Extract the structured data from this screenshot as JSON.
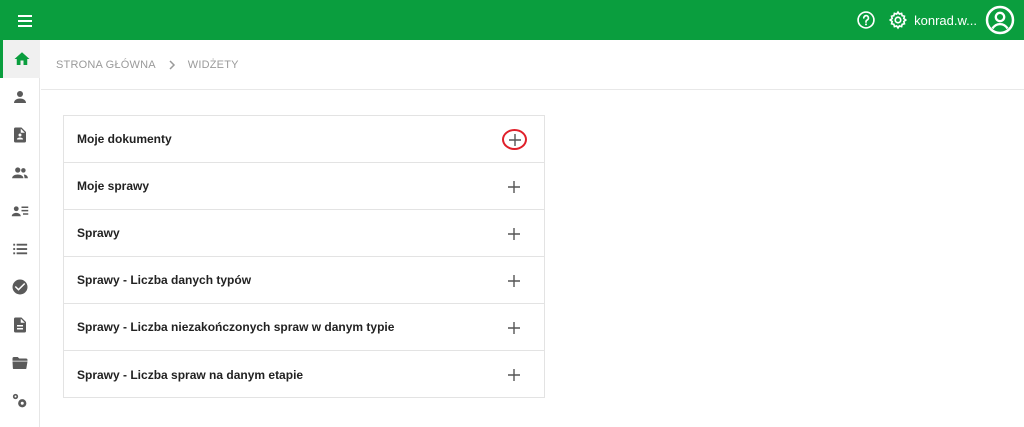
{
  "header": {
    "username": "konrad.w...",
    "menu_icon": "hamburger-menu-icon",
    "help_icon": "help-circle-icon",
    "settings_icon": "gear-icon",
    "avatar_icon": "user-account-icon",
    "brand_color": "#0a9e3e"
  },
  "sidebar": {
    "items": [
      {
        "icon": "home-icon",
        "active": true
      },
      {
        "icon": "person-icon"
      },
      {
        "icon": "contact-document-icon"
      },
      {
        "icon": "people-group-icon"
      },
      {
        "icon": "person-list-icon"
      },
      {
        "icon": "list-icon"
      },
      {
        "icon": "check-circle-icon"
      },
      {
        "icon": "document-icon"
      },
      {
        "icon": "folder-icon"
      },
      {
        "icon": "settings-cogs-icon"
      }
    ]
  },
  "breadcrumb": {
    "home": "STRONA GŁÓWNA",
    "current": "WIDŻETY"
  },
  "widgets": [
    {
      "label": "Moje dokumenty",
      "highlighted": true
    },
    {
      "label": "Moje sprawy"
    },
    {
      "label": "Sprawy"
    },
    {
      "label": "Sprawy - Liczba danych typów"
    },
    {
      "label": "Sprawy - Liczba niezakończonych spraw w danym typie"
    },
    {
      "label": "Sprawy - Liczba spraw na danym etapie"
    }
  ],
  "highlight_color": "#e0202a"
}
